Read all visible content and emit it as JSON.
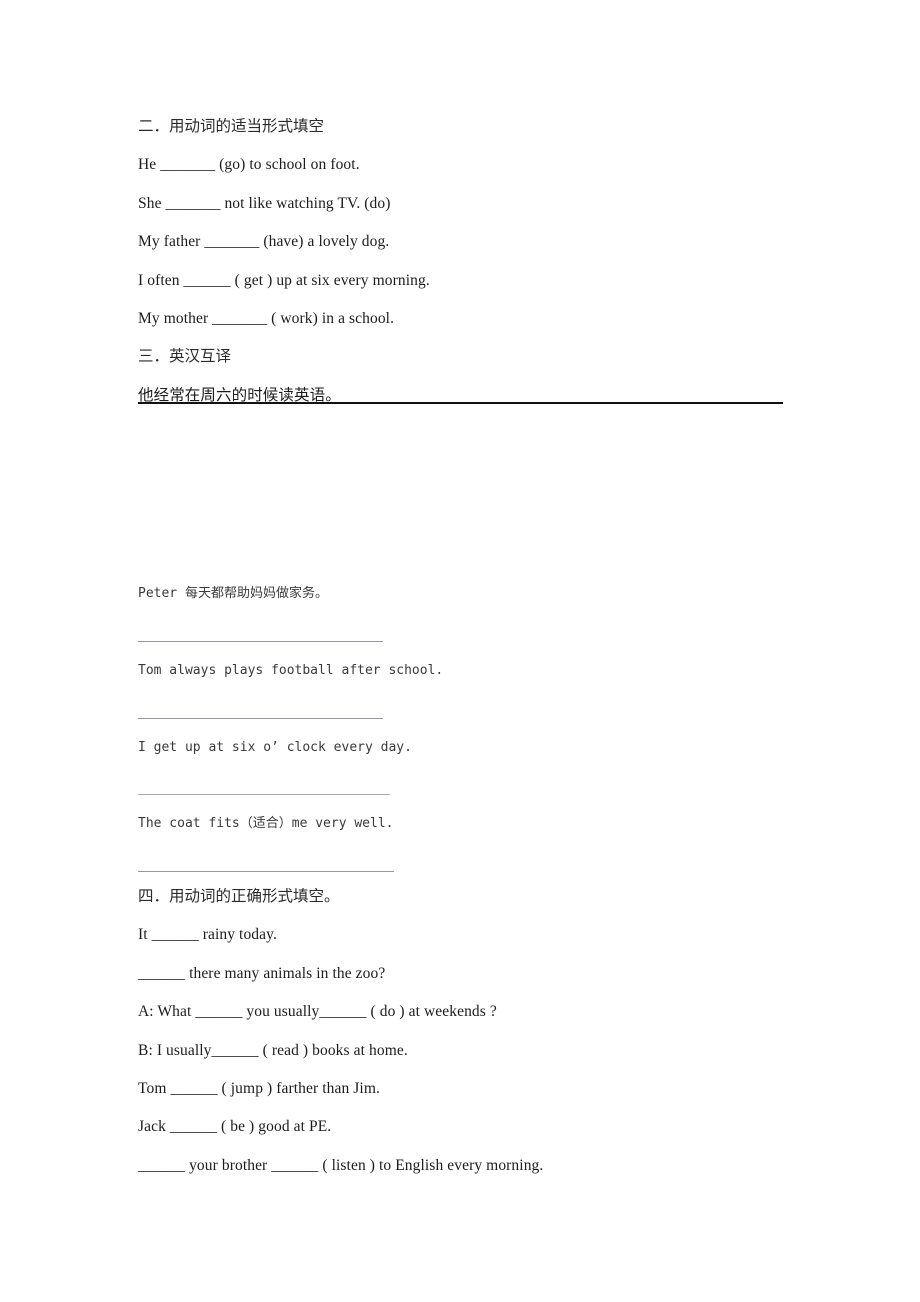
{
  "document": {
    "page_background": "#ffffff",
    "text_color": "#1c1c1c",
    "rule_color_black": "#111111",
    "rule_color_gray": "#9a93a0"
  },
  "section_two": {
    "heading": "二．用动词的适当形式填空",
    "items": [
      "He _______ (go) to school on foot.",
      "She _______ not like watching TV. (do)",
      "My father _______ (have) a lovely dog.",
      "I often ______ ( get ) up at six every morning.",
      "My mother _______ ( work) in a school."
    ]
  },
  "section_three": {
    "heading": "三．英汉互译",
    "first_sentence": "他经常在周六的时候读英语。",
    "mono_items": [
      "Peter 每天都帮助妈妈做家务。",
      "Tom always plays football after school.",
      "I get up at six o’ clock every day.",
      "The coat fits（适合）me very well."
    ],
    "answer_rule_widths": [
      "245px",
      "245px",
      "252px",
      "256px"
    ]
  },
  "section_four": {
    "heading": "四．用动词的正确形式填空。",
    "items": [
      "It ______ rainy today.",
      "______ there many animals in the zoo?",
      "A: What ______ you usually______ ( do ) at weekends ?",
      "B: I usually______ ( read ) books at home.",
      "Tom ______ ( jump ) farther than Jim.",
      "Jack ______ ( be ) good at PE.",
      "______ your brother ______ ( listen ) to English every morning."
    ]
  }
}
